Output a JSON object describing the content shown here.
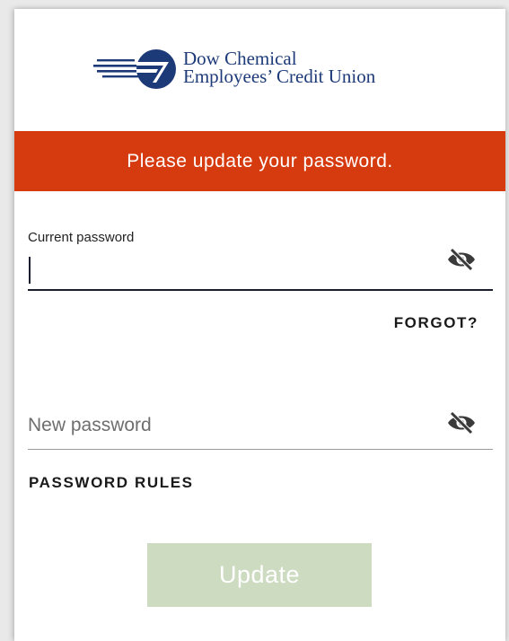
{
  "brand": {
    "line1": "Dow Chemical",
    "line2": "Employees’ Credit Union",
    "color": "#1d3a78"
  },
  "banner": {
    "message": "Please update your password.",
    "color": "#d63b0f"
  },
  "current_password": {
    "label": "Current password",
    "value": "",
    "toggle_icon": "eye-off-icon"
  },
  "forgot_link": "FORGOT?",
  "new_password": {
    "placeholder": "New password",
    "value": "",
    "toggle_icon": "eye-off-icon"
  },
  "password_rules_link": "PASSWORD RULES",
  "update_button": {
    "label": "Update",
    "color": "#cddbc1"
  }
}
